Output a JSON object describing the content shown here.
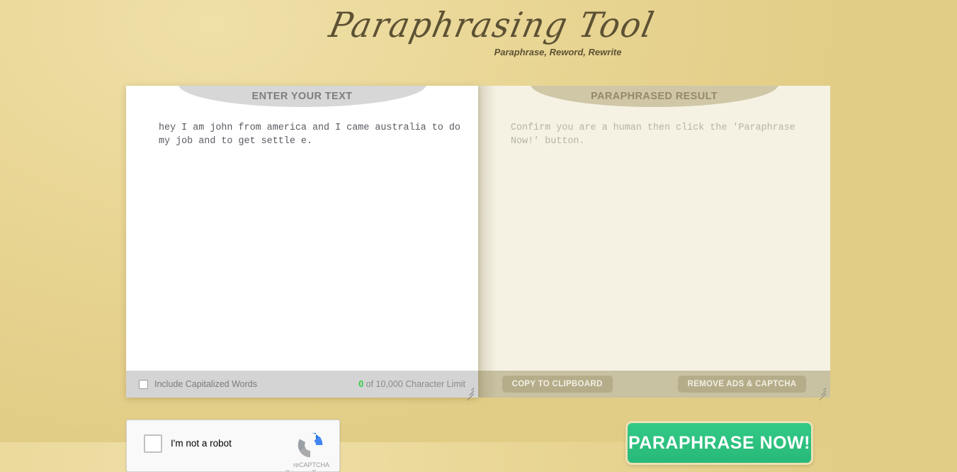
{
  "site": {
    "logo_title": "Paraphrasing Tool",
    "tagline": "Paraphrase, Reword, Rewrite"
  },
  "input_panel": {
    "header": "ENTER YOUR TEXT",
    "text": "hey I am john from america and I came australia to do my job and to get settle e.",
    "capitalize_label": "Include Capitalized Words",
    "char_count": "0",
    "char_limit_text": " of 10,000 Character Limit"
  },
  "result_panel": {
    "header": "PARAPHRASED RESULT",
    "placeholder": "Confirm you are a human then click the 'Paraphrase Now!' button.",
    "copy_button": "COPY TO CLIPBOARD",
    "remove_ads_button": "REMOVE ADS & CAPTCHA"
  },
  "captcha": {
    "label": "I'm not a robot",
    "brand": "reCAPTCHA",
    "legal": "Privacy - Terms"
  },
  "actions": {
    "paraphrase_now": "PARAPHRASE NOW!"
  },
  "colors": {
    "background": "#e8d593",
    "accent_green": "#2ec27e",
    "counter_green": "#2ecc40",
    "tan_button": "#b5ad8a"
  }
}
